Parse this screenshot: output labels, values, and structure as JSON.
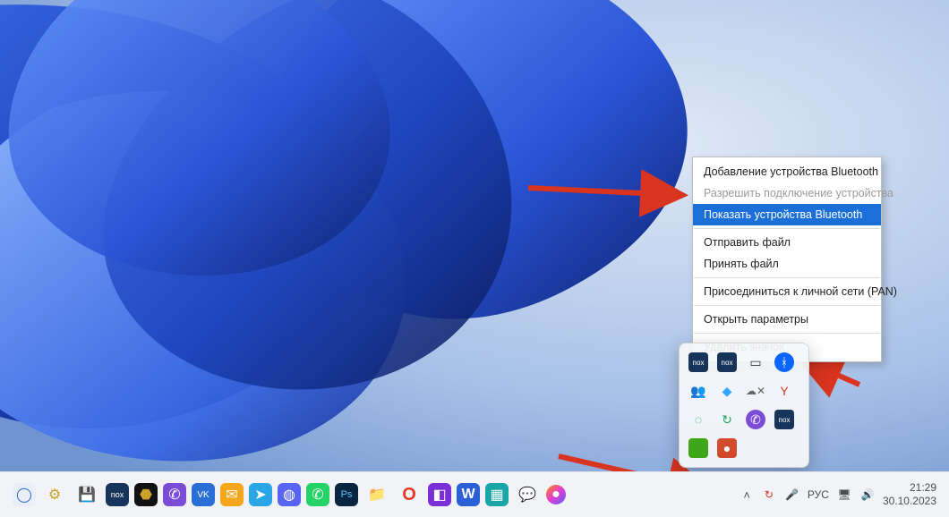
{
  "context_menu": {
    "items": [
      {
        "label": "Добавление устройства Bluetooth",
        "state": "normal"
      },
      {
        "label": "Разрешить подключение устройства",
        "state": "disabled"
      },
      {
        "label": "Показать устройства Bluetooth",
        "state": "highlight"
      },
      {
        "sep": true
      },
      {
        "label": "Отправить файл",
        "state": "normal"
      },
      {
        "label": "Принять файл",
        "state": "normal"
      },
      {
        "sep": true
      },
      {
        "label": "Присоединиться к личной сети (PAN)",
        "state": "normal"
      },
      {
        "sep": true
      },
      {
        "label": "Открыть параметры",
        "state": "normal"
      },
      {
        "sep": true
      },
      {
        "label": "Удалить значок",
        "state": "normal"
      }
    ]
  },
  "tray_flyout": {
    "icons": [
      {
        "name": "nox-app-icon",
        "glyph": "nox",
        "bg": "#17355a",
        "fg": "#fff",
        "fs": "8px"
      },
      {
        "name": "nox-duplicate-icon",
        "glyph": "nox",
        "bg": "#17355a",
        "fg": "#fff",
        "fs": "8px"
      },
      {
        "name": "phone-link-icon",
        "glyph": "▭",
        "bg": "transparent",
        "fg": "#333"
      },
      {
        "name": "bluetooth-icon",
        "glyph": "ᚼ",
        "bg": "#0a66ff",
        "fg": "#fff",
        "round": true
      },
      {
        "name": "teams-icon",
        "glyph": "👥",
        "bg": "transparent",
        "fg": "#5b5fc7"
      },
      {
        "name": "antivirus-icon",
        "glyph": "◆",
        "bg": "transparent",
        "fg": "#2fa6ff"
      },
      {
        "name": "cloud-sync-icon",
        "glyph": "☁✕",
        "bg": "transparent",
        "fg": "#666",
        "fs": "12px"
      },
      {
        "name": "yandex-icon",
        "glyph": "Y",
        "bg": "transparent",
        "fg": "#d13b2a"
      },
      {
        "name": "spinner-icon",
        "glyph": "◌",
        "bg": "transparent",
        "fg": "#1aa864"
      },
      {
        "name": "updater-icon",
        "glyph": "↻",
        "bg": "transparent",
        "fg": "#2aa35a"
      },
      {
        "name": "viber-icon",
        "glyph": "✆",
        "bg": "#7b4dd6",
        "fg": "#fff",
        "round": true
      },
      {
        "name": "nox-tray-icon",
        "glyph": "nox",
        "bg": "#17355a",
        "fg": "#fff",
        "fs": "8px"
      },
      {
        "name": "nvidia-icon",
        "glyph": "▇",
        "bg": "#3fa61a",
        "fg": "#3fa61a"
      },
      {
        "name": "record-icon",
        "glyph": "●",
        "bg": "#d24a2b",
        "fg": "#fff"
      }
    ]
  },
  "taskbar": {
    "apps": [
      {
        "name": "start-button",
        "glyph": "◯",
        "bg": "#e9eef7",
        "fg": "#2b6bd6"
      },
      {
        "name": "utility-1-icon",
        "glyph": "⚙",
        "bg": "transparent",
        "fg": "#caa12a"
      },
      {
        "name": "save-disk-icon",
        "glyph": "💾",
        "bg": "transparent",
        "fg": "#2b4fd6"
      },
      {
        "name": "nox-player-icon",
        "glyph": "nox",
        "bg": "#17355a",
        "fg": "#fff",
        "fs": "9px"
      },
      {
        "name": "cube-dark-icon",
        "glyph": "⬣",
        "bg": "#111",
        "fg": "#caa12a"
      },
      {
        "name": "viber-taskbar-icon",
        "glyph": "✆",
        "bg": "#7b4dd6",
        "fg": "#fff"
      },
      {
        "name": "vk-icon",
        "glyph": "VK",
        "bg": "#2a6fd6",
        "fg": "#fff",
        "fs": "10px"
      },
      {
        "name": "mail-icon",
        "glyph": "✉",
        "bg": "#f6a61a",
        "fg": "#fff"
      },
      {
        "name": "telegram-icon",
        "glyph": "➤",
        "bg": "#2aa6e6",
        "fg": "#fff"
      },
      {
        "name": "discord-icon",
        "glyph": "◍",
        "bg": "#5865f2",
        "fg": "#fff"
      },
      {
        "name": "whatsapp-icon",
        "glyph": "✆",
        "bg": "#25d366",
        "fg": "#fff"
      },
      {
        "name": "photoshop-icon",
        "glyph": "Ps",
        "bg": "#0a2540",
        "fg": "#5cc1ff",
        "fs": "11px"
      },
      {
        "name": "folder-warn-icon",
        "glyph": "📁",
        "bg": "transparent",
        "fg": "#f6a61a"
      },
      {
        "name": "opera-icon",
        "glyph": "O",
        "bg": "transparent",
        "fg": "#e23b2a",
        "fs": "20px",
        "bold": true
      },
      {
        "name": "app-purple-icon",
        "glyph": "◧",
        "bg": "#7b2fd6",
        "fg": "#fff"
      },
      {
        "name": "word-icon",
        "glyph": "W",
        "bg": "#2a5fd6",
        "fg": "#fff",
        "bold": true
      },
      {
        "name": "app-teal-icon",
        "glyph": "▦",
        "bg": "#1aa6a6",
        "fg": "#fff"
      },
      {
        "name": "chat-bubble-icon",
        "glyph": "💬",
        "bg": "transparent",
        "fg": "#6a6dd6"
      },
      {
        "name": "gradient-app-icon",
        "glyph": "●",
        "bg": "transparent",
        "fg": "#d64aa6",
        "grad": true
      }
    ],
    "systray": {
      "chevron": "˄",
      "sync": "↻",
      "mic": "🎤",
      "lang": "РУС",
      "net": "🖥",
      "vol": "🔊"
    },
    "clock": {
      "time": "21:29",
      "date": "30.10.2023"
    }
  }
}
